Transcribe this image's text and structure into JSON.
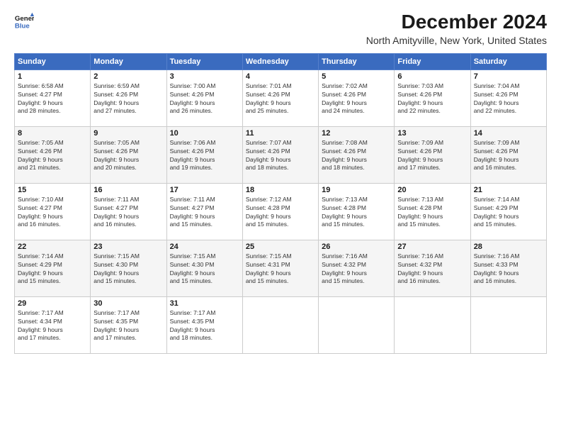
{
  "logo": {
    "line1": "General",
    "line2": "Blue"
  },
  "title": "December 2024",
  "subtitle": "North Amityville, New York, United States",
  "days_header": [
    "Sunday",
    "Monday",
    "Tuesday",
    "Wednesday",
    "Thursday",
    "Friday",
    "Saturday"
  ],
  "weeks": [
    [
      {
        "num": "1",
        "info": "Sunrise: 6:58 AM\nSunset: 4:27 PM\nDaylight: 9 hours\nand 28 minutes."
      },
      {
        "num": "2",
        "info": "Sunrise: 6:59 AM\nSunset: 4:26 PM\nDaylight: 9 hours\nand 27 minutes."
      },
      {
        "num": "3",
        "info": "Sunrise: 7:00 AM\nSunset: 4:26 PM\nDaylight: 9 hours\nand 26 minutes."
      },
      {
        "num": "4",
        "info": "Sunrise: 7:01 AM\nSunset: 4:26 PM\nDaylight: 9 hours\nand 25 minutes."
      },
      {
        "num": "5",
        "info": "Sunrise: 7:02 AM\nSunset: 4:26 PM\nDaylight: 9 hours\nand 24 minutes."
      },
      {
        "num": "6",
        "info": "Sunrise: 7:03 AM\nSunset: 4:26 PM\nDaylight: 9 hours\nand 22 minutes."
      },
      {
        "num": "7",
        "info": "Sunrise: 7:04 AM\nSunset: 4:26 PM\nDaylight: 9 hours\nand 22 minutes."
      }
    ],
    [
      {
        "num": "8",
        "info": "Sunrise: 7:05 AM\nSunset: 4:26 PM\nDaylight: 9 hours\nand 21 minutes."
      },
      {
        "num": "9",
        "info": "Sunrise: 7:05 AM\nSunset: 4:26 PM\nDaylight: 9 hours\nand 20 minutes."
      },
      {
        "num": "10",
        "info": "Sunrise: 7:06 AM\nSunset: 4:26 PM\nDaylight: 9 hours\nand 19 minutes."
      },
      {
        "num": "11",
        "info": "Sunrise: 7:07 AM\nSunset: 4:26 PM\nDaylight: 9 hours\nand 18 minutes."
      },
      {
        "num": "12",
        "info": "Sunrise: 7:08 AM\nSunset: 4:26 PM\nDaylight: 9 hours\nand 18 minutes."
      },
      {
        "num": "13",
        "info": "Sunrise: 7:09 AM\nSunset: 4:26 PM\nDaylight: 9 hours\nand 17 minutes."
      },
      {
        "num": "14",
        "info": "Sunrise: 7:09 AM\nSunset: 4:26 PM\nDaylight: 9 hours\nand 16 minutes."
      }
    ],
    [
      {
        "num": "15",
        "info": "Sunrise: 7:10 AM\nSunset: 4:27 PM\nDaylight: 9 hours\nand 16 minutes."
      },
      {
        "num": "16",
        "info": "Sunrise: 7:11 AM\nSunset: 4:27 PM\nDaylight: 9 hours\nand 16 minutes."
      },
      {
        "num": "17",
        "info": "Sunrise: 7:11 AM\nSunset: 4:27 PM\nDaylight: 9 hours\nand 15 minutes."
      },
      {
        "num": "18",
        "info": "Sunrise: 7:12 AM\nSunset: 4:28 PM\nDaylight: 9 hours\nand 15 minutes."
      },
      {
        "num": "19",
        "info": "Sunrise: 7:13 AM\nSunset: 4:28 PM\nDaylight: 9 hours\nand 15 minutes."
      },
      {
        "num": "20",
        "info": "Sunrise: 7:13 AM\nSunset: 4:28 PM\nDaylight: 9 hours\nand 15 minutes."
      },
      {
        "num": "21",
        "info": "Sunrise: 7:14 AM\nSunset: 4:29 PM\nDaylight: 9 hours\nand 15 minutes."
      }
    ],
    [
      {
        "num": "22",
        "info": "Sunrise: 7:14 AM\nSunset: 4:29 PM\nDaylight: 9 hours\nand 15 minutes."
      },
      {
        "num": "23",
        "info": "Sunrise: 7:15 AM\nSunset: 4:30 PM\nDaylight: 9 hours\nand 15 minutes."
      },
      {
        "num": "24",
        "info": "Sunrise: 7:15 AM\nSunset: 4:30 PM\nDaylight: 9 hours\nand 15 minutes."
      },
      {
        "num": "25",
        "info": "Sunrise: 7:15 AM\nSunset: 4:31 PM\nDaylight: 9 hours\nand 15 minutes."
      },
      {
        "num": "26",
        "info": "Sunrise: 7:16 AM\nSunset: 4:32 PM\nDaylight: 9 hours\nand 15 minutes."
      },
      {
        "num": "27",
        "info": "Sunrise: 7:16 AM\nSunset: 4:32 PM\nDaylight: 9 hours\nand 16 minutes."
      },
      {
        "num": "28",
        "info": "Sunrise: 7:16 AM\nSunset: 4:33 PM\nDaylight: 9 hours\nand 16 minutes."
      }
    ],
    [
      {
        "num": "29",
        "info": "Sunrise: 7:17 AM\nSunset: 4:34 PM\nDaylight: 9 hours\nand 17 minutes."
      },
      {
        "num": "30",
        "info": "Sunrise: 7:17 AM\nSunset: 4:35 PM\nDaylight: 9 hours\nand 17 minutes."
      },
      {
        "num": "31",
        "info": "Sunrise: 7:17 AM\nSunset: 4:35 PM\nDaylight: 9 hours\nand 18 minutes."
      },
      null,
      null,
      null,
      null
    ]
  ]
}
